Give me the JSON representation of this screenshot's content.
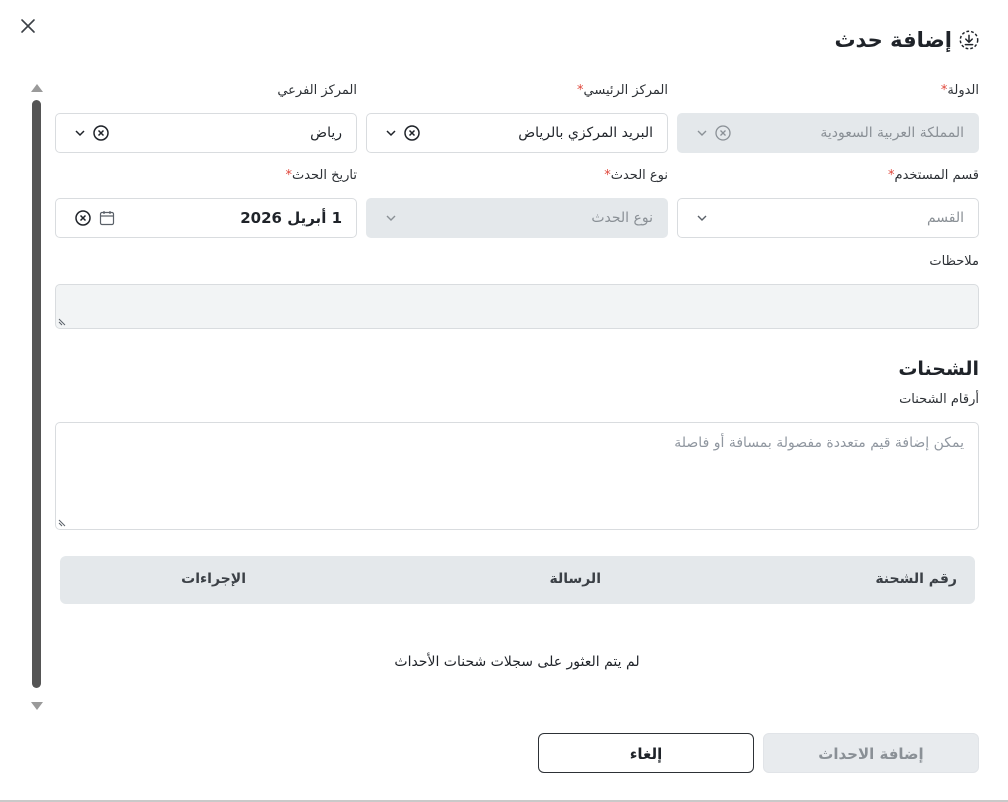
{
  "dialog": {
    "title": "إضافة حدث",
    "close_icon": "close-icon",
    "title_icon": "download-circle-icon"
  },
  "fields": {
    "country": {
      "label": "الدولة",
      "required": "*",
      "value": "المملكة العربية السعودية",
      "disabled": true
    },
    "main_center": {
      "label": "المركز الرئيسي",
      "required": "*",
      "value": "البريد المركزي بالرياض"
    },
    "sub_center": {
      "label": "المركز الفرعي",
      "value": "رياض"
    },
    "user_department": {
      "label": "قسم المستخدم",
      "required": "*",
      "placeholder": "القسم"
    },
    "event_type": {
      "label": "نوع الحدث",
      "required": "*",
      "placeholder": "نوع الحدث",
      "disabled": true
    },
    "event_date": {
      "label": "تاريخ الحدث",
      "required": "*",
      "value": "1 أبريل 2026"
    },
    "notes": {
      "label": "ملاحظات",
      "value": ""
    }
  },
  "shipments": {
    "section_title": "الشحنات",
    "numbers_label": "أرقام الشحنات",
    "numbers_placeholder": "يمكن إضافة قيم متعددة مفصولة بمسافة أو فاصلة",
    "table": {
      "columns": [
        "رقم الشحنة",
        "الرسالة",
        "الإجراءات"
      ]
    },
    "empty_message": "لم يتم العثور على سجلات شحنات الأحداث"
  },
  "actions": {
    "submit_label": "إضافة الاحداث",
    "cancel_label": "إلغاء"
  },
  "colors": {
    "required": "#e0463a",
    "disabled_bg": "#e4e8eb",
    "table_header_bg": "#e4e8eb"
  }
}
